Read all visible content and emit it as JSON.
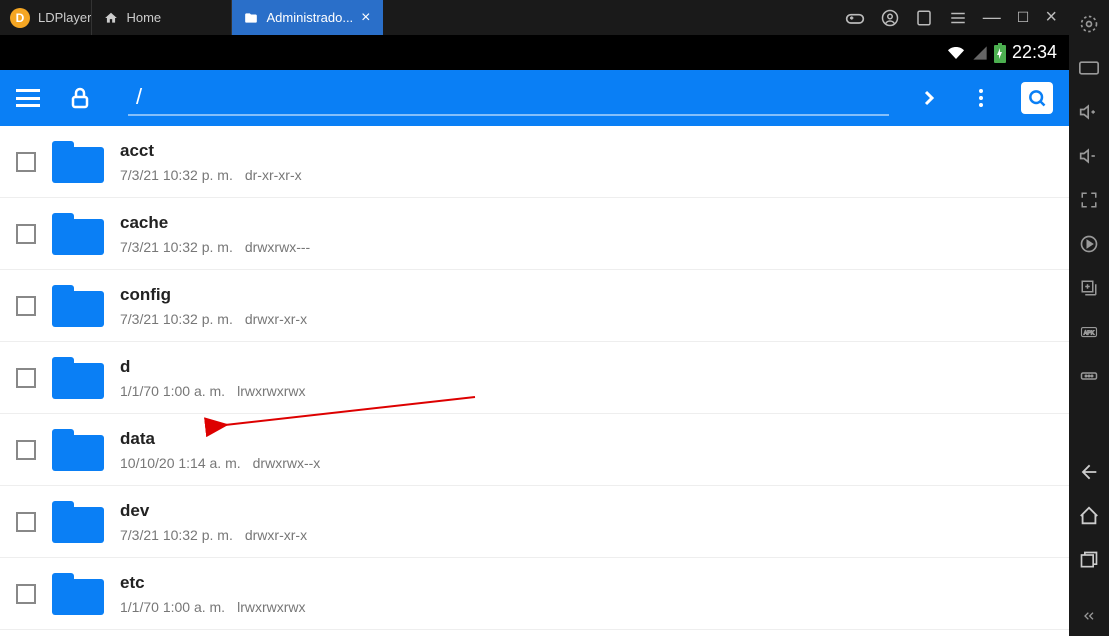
{
  "titlebar": {
    "app_name": "LDPlayer",
    "tabs": [
      {
        "label": "Home",
        "active": false
      },
      {
        "label": "Administrado...",
        "active": true
      }
    ]
  },
  "android_status": {
    "time": "22:34"
  },
  "toolbar": {
    "path": "/"
  },
  "files": [
    {
      "name": "acct",
      "date": "7/3/21 10:32 p. m.",
      "perms": "dr-xr-xr-x"
    },
    {
      "name": "cache",
      "date": "7/3/21 10:32 p. m.",
      "perms": "drwxrwx---"
    },
    {
      "name": "config",
      "date": "7/3/21 10:32 p. m.",
      "perms": "drwxr-xr-x"
    },
    {
      "name": "d",
      "date": "1/1/70 1:00 a. m.",
      "perms": "lrwxrwxrwx"
    },
    {
      "name": "data",
      "date": "10/10/20 1:14 a. m.",
      "perms": "drwxrwx--x"
    },
    {
      "name": "dev",
      "date": "7/3/21 10:32 p. m.",
      "perms": "drwxr-xr-x"
    },
    {
      "name": "etc",
      "date": "1/1/70 1:00 a. m.",
      "perms": "lrwxrwxrwx"
    }
  ]
}
